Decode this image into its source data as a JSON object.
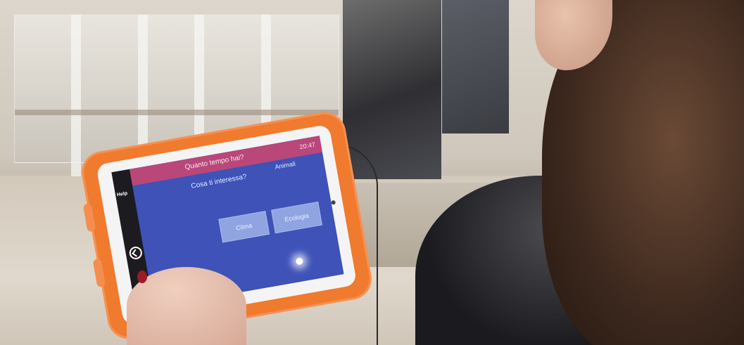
{
  "tablet_screen": {
    "header_title": "Quanto tempo hai?",
    "status": "20:47",
    "side_label": "Help",
    "question": "Cosa ti interessa?",
    "category_label": "Animali",
    "options": [
      "Clima",
      "Ecologia"
    ]
  },
  "colors": {
    "case": "#f07a2e",
    "screen_bg": "#3e52b8",
    "header_bar": "#b9477a",
    "button": "#8fa4e0"
  }
}
